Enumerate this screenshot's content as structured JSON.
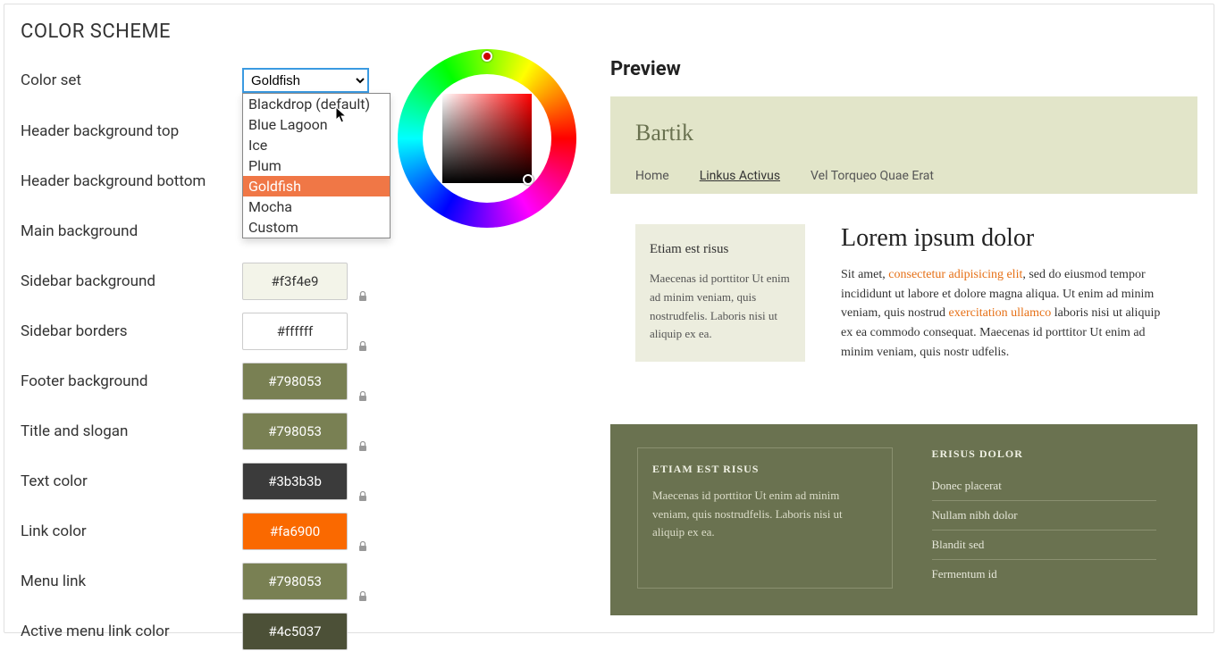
{
  "panel": {
    "title": "COLOR SCHEME"
  },
  "color_set": {
    "label": "Color set",
    "selected": "Goldfish",
    "options": [
      "Blackdrop (default)",
      "Blue Lagoon",
      "Ice",
      "Plum",
      "Goldfish",
      "Mocha",
      "Custom"
    ],
    "highlighted_index": 4
  },
  "fields": [
    {
      "label": "Header background top",
      "value": "",
      "bg": "",
      "light": true,
      "lock": false
    },
    {
      "label": "Header background bottom",
      "value": "",
      "bg": "",
      "light": true,
      "lock": false
    },
    {
      "label": "Main background",
      "value": "",
      "bg": "",
      "light": true,
      "lock": false
    },
    {
      "label": "Sidebar background",
      "value": "#f3f4e9",
      "bg": "#f3f4e9",
      "light": true,
      "lock": true
    },
    {
      "label": "Sidebar borders",
      "value": "#ffffff",
      "bg": "#ffffff",
      "light": true,
      "lock": true
    },
    {
      "label": "Footer background",
      "value": "#798053",
      "bg": "#798053",
      "light": false,
      "lock": true
    },
    {
      "label": "Title and slogan",
      "value": "#798053",
      "bg": "#798053",
      "light": false,
      "lock": true
    },
    {
      "label": "Text color",
      "value": "#3b3b3b",
      "bg": "#3b3b3b",
      "light": false,
      "lock": true
    },
    {
      "label": "Link color",
      "value": "#fa6900",
      "bg": "#fa6900",
      "light": false,
      "lock": true
    },
    {
      "label": "Menu link",
      "value": "#798053",
      "bg": "#798053",
      "light": false,
      "lock": true
    },
    {
      "label": "Active menu link color",
      "value": "#4c5037",
      "bg": "#4c5037",
      "light": false,
      "lock": false
    }
  ],
  "preview": {
    "heading": "Preview",
    "site_name": "Bartik",
    "nav": [
      "Home",
      "Linkus Activus",
      "Vel Torqueo Quae Erat"
    ],
    "active_nav_index": 1,
    "sidebar": {
      "title": "Etiam est risus",
      "body": "Maecenas id porttitor Ut enim ad minim veniam, quis nostrudfelis. Laboris nisi ut aliquip ex ea."
    },
    "content": {
      "title": "Lorem ipsum dolor",
      "body_pre": "Sit amet, ",
      "link1": "consectetur adipisicing elit",
      "body_mid": ", sed do eiusmod tempor incididunt ut labore et dolore magna aliqua. Ut enim ad minim veniam, quis nostrud ",
      "link2": "exercitation ullamco",
      "body_post": " laboris nisi ut aliquip ex ea commodo consequat. Maecenas id porttitor Ut enim ad minim veniam, quis nostr udfelis."
    },
    "footer": {
      "left": {
        "title": "ETIAM EST RISUS",
        "body": "Maecenas id porttitor Ut enim ad minim veniam, quis nostrudfelis. Laboris nisi ut aliquip ex ea."
      },
      "right": {
        "title": "ERISUS DOLOR",
        "items": [
          "Donec placerat",
          "Nullam nibh dolor",
          "Blandit sed",
          "Fermentum id"
        ]
      }
    }
  },
  "colors": {
    "accent": "#fa6900",
    "olive": "#798053",
    "olive_dark": "#4c5037",
    "sidebar_bg": "#f3f4e9"
  }
}
